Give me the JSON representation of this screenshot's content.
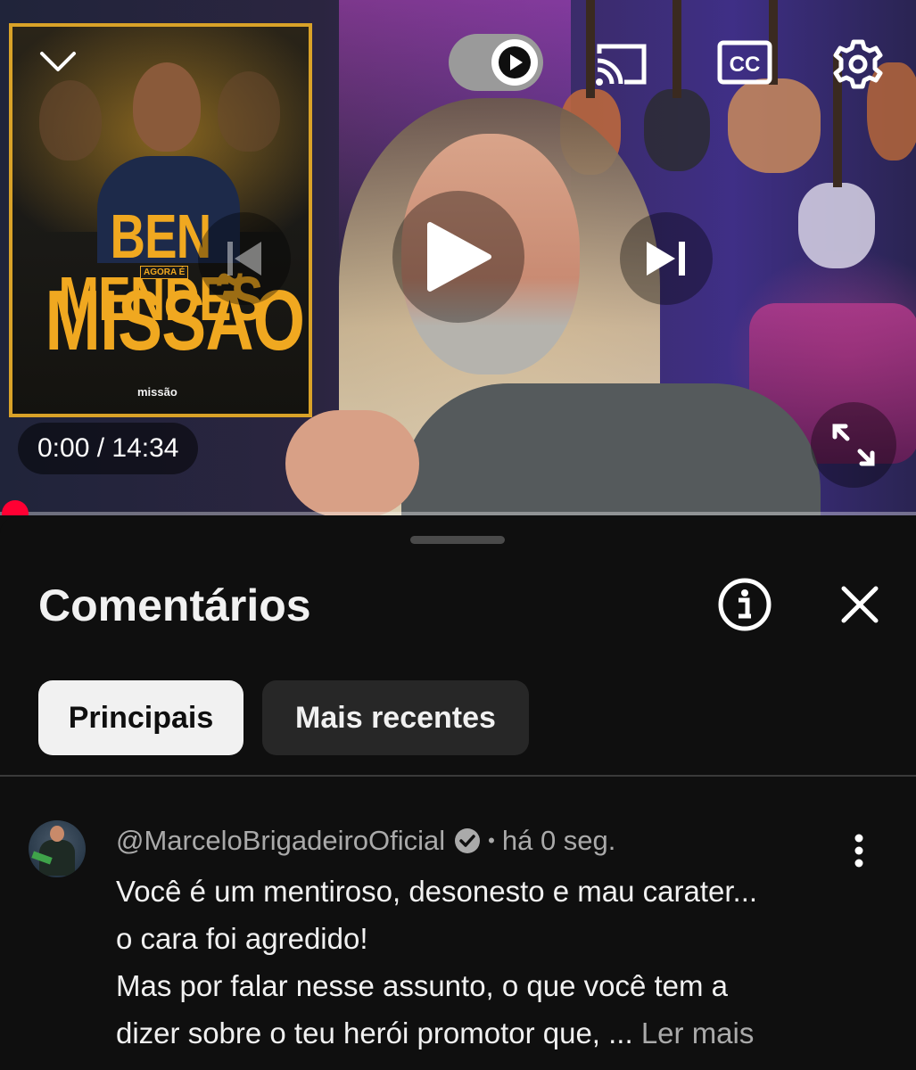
{
  "player": {
    "poster": {
      "name": "BEN MENDES",
      "tag": "AGORA É",
      "word": "MISSÃO",
      "logo": "missão"
    },
    "time_display": "0:00 / 14:34",
    "progress": 0.0,
    "autoplay_on": true,
    "icons": [
      "chevron-down-icon",
      "autoplay-icon",
      "cast-icon",
      "cc-icon",
      "gear-icon",
      "previous-icon",
      "play-icon",
      "next-icon",
      "fullscreen-icon"
    ],
    "cc_label": "CC"
  },
  "comments_panel": {
    "title": "Comentários",
    "chips": [
      {
        "label": "Principais",
        "selected": true
      },
      {
        "label": "Mais recentes",
        "selected": false
      }
    ],
    "comment": {
      "author": "@MarceloBrigadeiroOficial",
      "verified": true,
      "separator": "•",
      "time": "há 0 seg.",
      "lines": [
        "Você é um mentiroso, desonesto e mau carater...",
        "o cara foi agredido!",
        "Mas por falar nesse assunto, o que você tem a",
        "dizer sobre o teu herói promotor que, ..."
      ],
      "read_more": "Ler mais"
    }
  },
  "colors": {
    "background": "#0f0f0f",
    "accent_red": "#ff0033",
    "poster_gold": "#d9a228",
    "chip_selected": "#f1f1f1",
    "chip_unselected": "#272727",
    "secondary_text": "#aaaaaa"
  }
}
